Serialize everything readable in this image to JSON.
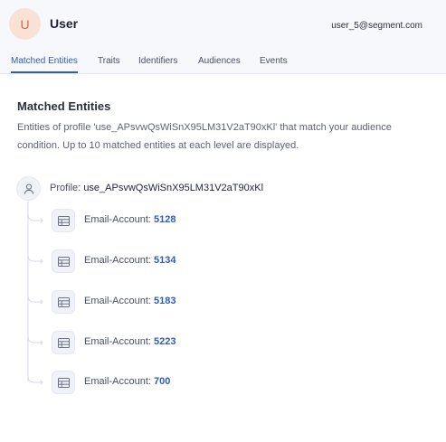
{
  "header": {
    "avatar_initial": "U",
    "user_name": "User",
    "user_email": "user_5@segment.com"
  },
  "tabs": [
    {
      "label": "Matched Entities",
      "active": true
    },
    {
      "label": "Traits",
      "active": false
    },
    {
      "label": "Identifiers",
      "active": false
    },
    {
      "label": "Audiences",
      "active": false
    },
    {
      "label": "Events",
      "active": false
    }
  ],
  "main": {
    "title": "Matched Entities",
    "description": "Entities of profile 'use_APsvwQsWiSnX95LM31V2aT90xKl' that match your audience condition. Up to 10 matched entities at each level are displayed.",
    "profile_prefix": "Profile:",
    "profile_id": "use_APsvwQsWiSnX95LM31V2aT90xKl",
    "entities": [
      {
        "type": "Email-Account:",
        "id": "5128"
      },
      {
        "type": "Email-Account:",
        "id": "5134"
      },
      {
        "type": "Email-Account:",
        "id": "5183"
      },
      {
        "type": "Email-Account:",
        "id": "5223"
      },
      {
        "type": "Email-Account:",
        "id": "700"
      }
    ]
  },
  "colors": {
    "accent": "#2f5cb8",
    "header_bg": "#f7f8fc",
    "avatar_bg": "#fae1d6"
  },
  "icons": {
    "profile": "person-icon",
    "entity": "table-icon"
  }
}
